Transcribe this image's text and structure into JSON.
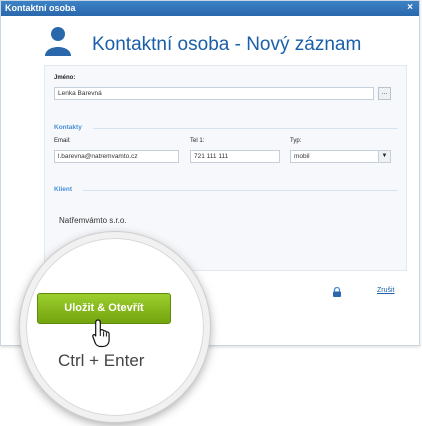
{
  "window": {
    "title": "Kontaktní osoba",
    "close_glyph": "×"
  },
  "header": {
    "title": "Kontaktní osoba - Nový záznam",
    "icon": "user-icon"
  },
  "form": {
    "name_label": "Jméno:",
    "name_value": "Lenka Barevná",
    "browse_label": "...",
    "contacts_section": "Kontakty",
    "email_label": "Email:",
    "email_value": "l.barevna@natremvamto.cz",
    "phone_label": "Tel 1:",
    "phone_value": "721 111 111",
    "type_label": "Typ:",
    "type_value": "mobil",
    "client_section": "Klient",
    "client_value": "Natřemvámto s.r.o."
  },
  "footer": {
    "cancel_label": "Zrušit",
    "save_label": "Uložit & Otevřít",
    "shortcut": "Ctrl + Enter"
  },
  "colors": {
    "titlebar": "#2f72b8",
    "accent": "#1b5fa8",
    "section": "#4a90d9",
    "save_button": "#8cc11f"
  }
}
